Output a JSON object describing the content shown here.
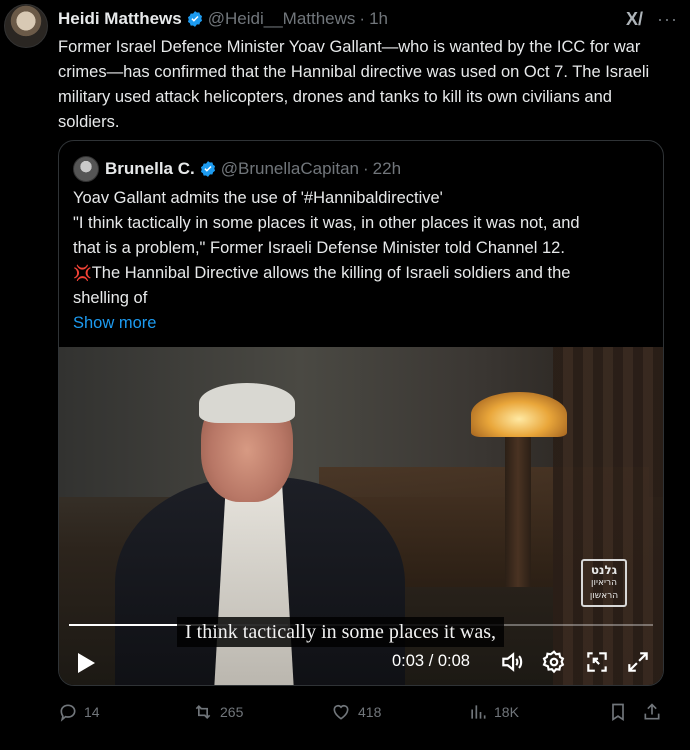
{
  "tweet": {
    "author_name": "Heidi Matthews",
    "handle": "@Heidi__Matthews",
    "separator": "·",
    "time": "1h",
    "text": "Former Israel Defence Minister Yoav Gallant—who is wanted by the ICC for war crimes—has confirmed that the Hannibal directive was used on Oct 7. The Israeli military used attack helicopters, drones and tanks to kill its own civilians and soldiers.",
    "grok_label": "X/",
    "more_label": "···"
  },
  "quote": {
    "author_name": "Brunella C.",
    "handle": "@BrunellaCapitan",
    "separator": "·",
    "time": "22h",
    "lines": [
      "Yoav Gallant admits the use of '#Hannibaldirective'",
      "\"I think tactically in some places it was, in other places it was not, and",
      "that is a problem,\" Former Israeli Defense Minister told Channel 12.",
      "The Hannibal Directive allows the killing of Israeli soldiers and the",
      "shelling of"
    ],
    "anger_emoji": "💢",
    "show_more": "Show more"
  },
  "video": {
    "subtitle": "I think tactically in some places it was,",
    "time_display": "0:03 / 0:08",
    "progress": 0.375,
    "watermark": {
      "line1": "גלנט",
      "line2": "הריאיון",
      "line3": "הראשון"
    }
  },
  "actions": {
    "replies": "14",
    "reposts": "265",
    "likes": "418",
    "views": "18K"
  },
  "colors": {
    "accent": "#1d9bf0",
    "muted": "#71767b",
    "text": "#e7e9ea",
    "border": "#2f3336"
  }
}
